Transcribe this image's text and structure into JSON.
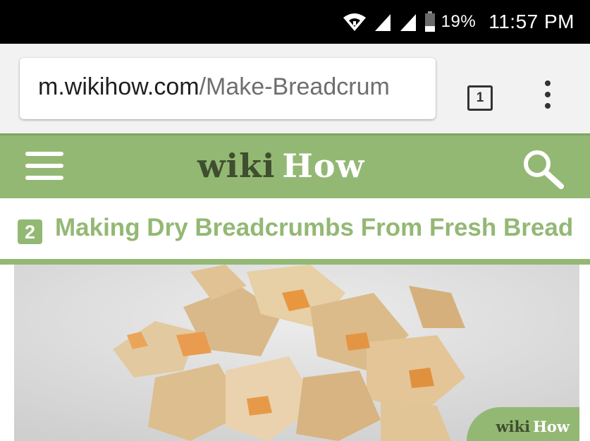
{
  "status_bar": {
    "battery_percent": "19%",
    "time": "11:57 PM",
    "icons": [
      "wifi-icon",
      "signal-icon",
      "signal-icon",
      "battery-icon"
    ]
  },
  "browser": {
    "url_host": "m.wikihow.com",
    "url_path": "/Make-Breadcrum",
    "tab_count": "1",
    "menu_icon": "more-vert-icon"
  },
  "site_header": {
    "logo_wiki": "wiki",
    "logo_how": "How",
    "menu_icon": "hamburger-icon",
    "search_icon": "search-icon",
    "brand_color": "#93b874"
  },
  "step": {
    "number": "2",
    "title": "Making Dry Breadcrumbs From Fresh Bread"
  },
  "image": {
    "subject": "breadcrumbs-photo",
    "watermark_wiki": "wiki",
    "watermark_how": "How"
  }
}
